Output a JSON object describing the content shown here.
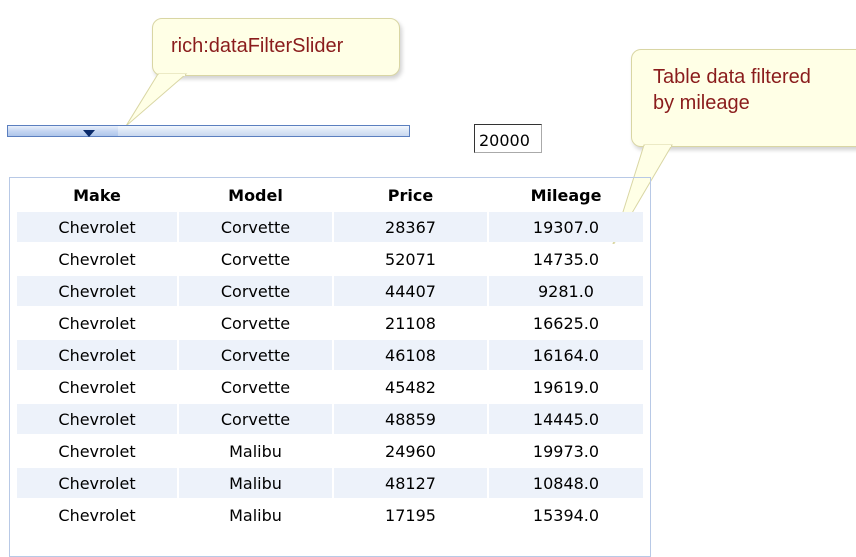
{
  "callouts": {
    "slider": "rich:dataFilterSlider",
    "table_line1": "Table data filtered",
    "table_line2": "by mileage"
  },
  "filter": {
    "value": "20000"
  },
  "table": {
    "headers": [
      "Make",
      "Model",
      "Price",
      "Mileage"
    ],
    "rows": [
      [
        "Chevrolet",
        "Corvette",
        "28367",
        "19307.0"
      ],
      [
        "Chevrolet",
        "Corvette",
        "52071",
        "14735.0"
      ],
      [
        "Chevrolet",
        "Corvette",
        "44407",
        "9281.0"
      ],
      [
        "Chevrolet",
        "Corvette",
        "21108",
        "16625.0"
      ],
      [
        "Chevrolet",
        "Corvette",
        "46108",
        "16164.0"
      ],
      [
        "Chevrolet",
        "Corvette",
        "45482",
        "19619.0"
      ],
      [
        "Chevrolet",
        "Corvette",
        "48859",
        "14445.0"
      ],
      [
        "Chevrolet",
        "Malibu",
        "24960",
        "19973.0"
      ],
      [
        "Chevrolet",
        "Malibu",
        "48127",
        "10848.0"
      ],
      [
        "Chevrolet",
        "Malibu",
        "17195",
        "15394.0"
      ]
    ]
  },
  "colors": {
    "callout_text": "#8a1c1c",
    "callout_bg": "#ffffe6",
    "row_stripe": "#edf2fa",
    "table_border": "#b8c9e6"
  }
}
